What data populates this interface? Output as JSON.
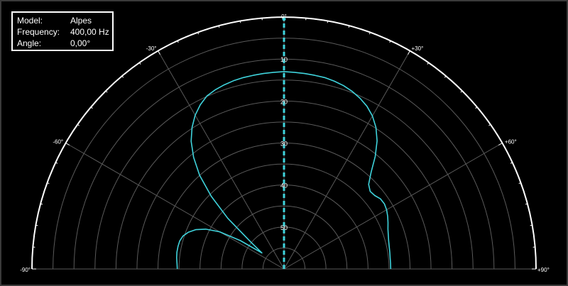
{
  "info": {
    "model_label": "Model:",
    "model_value": "Alpes",
    "frequency_label": "Frequency:",
    "frequency_value": "400,00 Hz",
    "angle_label": "Angle:",
    "angle_value": "0,00°"
  },
  "chart_data": {
    "type": "polar",
    "title": "",
    "angle_range_deg": [
      -90,
      90
    ],
    "angle_ticks": [
      "-90°",
      "-60°",
      "-30°",
      "0°",
      "+30°",
      "+60°",
      "+90°"
    ],
    "radial_ticks": [
      "10",
      "20",
      "30",
      "40",
      "50"
    ],
    "radial_range_db": [
      -60,
      0
    ],
    "rings_db": [
      -5,
      -10,
      -15,
      -20,
      -25,
      -30,
      -35,
      -40,
      -45,
      -50,
      -55
    ],
    "marker_angle_deg": 0,
    "colors": {
      "curve": "#3fd3dc",
      "marker": "#3fd3dc",
      "grid": "#5a5a5a",
      "outline": "#ffffff",
      "text": "#ffffff"
    },
    "series": [
      {
        "angles_deg": [
          -90,
          -87,
          -84,
          -81,
          -78,
          -75,
          -72,
          -69,
          -66,
          -63,
          -60,
          -57,
          -54,
          -51,
          -48,
          -45,
          -42,
          -39,
          -36,
          -33,
          -30,
          -27,
          -24,
          -21,
          -18,
          -15,
          -12,
          -9,
          -6,
          -3,
          0,
          3,
          6,
          9,
          12,
          15,
          18,
          21,
          24,
          27,
          30,
          33,
          36,
          39,
          42,
          45,
          48,
          51,
          54,
          57,
          60,
          63,
          66,
          69,
          72,
          75,
          78,
          81,
          84,
          87,
          90
        ],
        "level_db": [
          -34.6,
          -34.5,
          -34.3,
          -34.2,
          -34.2,
          -34.3,
          -34.7,
          -35.6,
          -37.0,
          -39.1,
          -42.3,
          -47.6,
          -53.5,
          -50.0,
          -42.0,
          -35.5,
          -30.0,
          -25.8,
          -22.4,
          -19.8,
          -17.7,
          -16.1,
          -14.9,
          -14.3,
          -13.9,
          -13.6,
          -13.4,
          -13.3,
          -13.2,
          -13.1,
          -13.0,
          -13.1,
          -13.2,
          -13.3,
          -13.4,
          -13.7,
          -14.1,
          -14.7,
          -15.5,
          -16.5,
          -17.9,
          -19.8,
          -22.3,
          -25.5,
          -29.0,
          -31.5,
          -32.4,
          -32.2,
          -31.6,
          -31.5,
          -31.8,
          -32.3,
          -32.9,
          -33.5,
          -33.9,
          -34.2,
          -34.4,
          -34.5,
          -34.6,
          -34.6,
          -34.6
        ]
      }
    ]
  }
}
